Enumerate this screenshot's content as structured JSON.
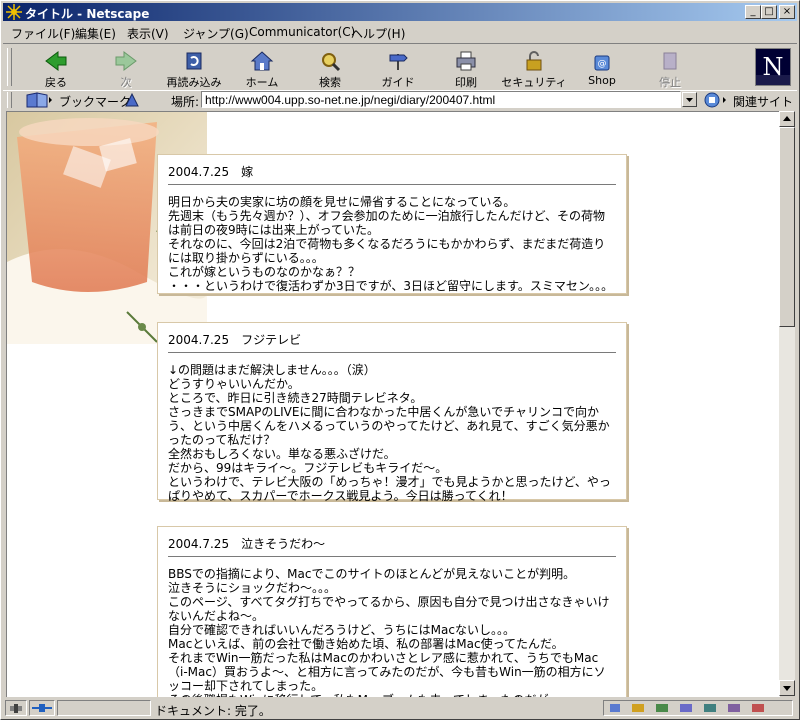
{
  "window": {
    "title": "タイトル - Netscape",
    "minimize": "_",
    "maximize": "□",
    "close": "×"
  },
  "menu": [
    "ファイル(F)",
    "編集(E)",
    "表示(V)",
    "ジャンプ(G)",
    "Communicator(C)",
    "ヘルプ(H)"
  ],
  "toolbar": {
    "back": "戻る",
    "forward": "次",
    "reload": "再読み込み",
    "home": "ホーム",
    "search": "検索",
    "guide": "ガイド",
    "print": "印刷",
    "security": "セキュリティ",
    "shop": "Shop",
    "stop": "停止",
    "logo_letter": "N"
  },
  "location": {
    "bookmarks": "ブックマーク",
    "label": "場所:",
    "url": "http://www004.upp.so-net.ne.jp/negi/diary/200407.html",
    "related": "関連サイト"
  },
  "entries": [
    {
      "head": "2004.7.25　嫁",
      "body": "明日から夫の実家に坊の顔を見せに帰省することになっている。\n先週末（もう先々週か？）、オフ会参加のために一泊旅行したんだけど、その荷物は前日の夜9時には出来上がっていた。\nそれなのに、今回は2泊で荷物も多くなるだろうにもかかわらず、まだまだ荷造りには取り掛からずにいる。。。\nこれが嫁というものなのかなぁ？？\n・・・というわけで復活わずか3日ですが、3日ほど留守にします。スミマセン。。。"
    },
    {
      "head": "2004.7.25　フジテレビ",
      "body": "↓の問題はまだ解決しません。。。（涙）\nどうすりゃいいんだか。\nところで、昨日に引き続き27時間テレビネタ。\nさっきまでSMAPのLIVEに間に合わなかった中居くんが急いでチャリンコで向かう、という中居くんをハメるっていうのやってたけど、あれ見て、すごく気分悪かったのって私だけ？\n全然おもしろくない。単なる悪ふざけだ。\nだから、99はキライ〜。フジテレビもキライだ〜。\nというわけで、テレビ大阪の「めっちゃ！漫才」でも見ようかと思ったけど、やっぱりやめて、スカパーでホークス戦見よう。今日は勝ってくれ！"
    },
    {
      "head": "2004.7.25　泣きそうだわ〜",
      "body": "BBSでの指摘により、Macでこのサイトのほとんどが見えないことが判明。\n泣きそうにショックだわ〜。。。\nこのページ、すべてタグ打ちでやってるから、原因も自分で見つけ出さなきゃいけないんだよね〜。\n自分で確認できればいいんだろうけど、うちにはMacないし。。。\nMacといえば、前の会社で働き始めた頃、私の部署はMac使ってたんだ。\nそれまでWin一筋だった私はMacのかわいさとレア感に惹かれて、うちでもMac（i-Mac）買おうよ〜、と相方に言ってみたのだが、今も昔もWin一筋の相方にソッコー却下されてしまった。\nその後職場もWinに移行して、私もMacブームも去ってしまったのだが。。。"
    }
  ],
  "status": {
    "text": "ドキュメント: 完了。"
  },
  "colors": {
    "titlebar_start": "#0a246a",
    "titlebar_end": "#a6caf0",
    "chrome": "#d4d0c8"
  }
}
